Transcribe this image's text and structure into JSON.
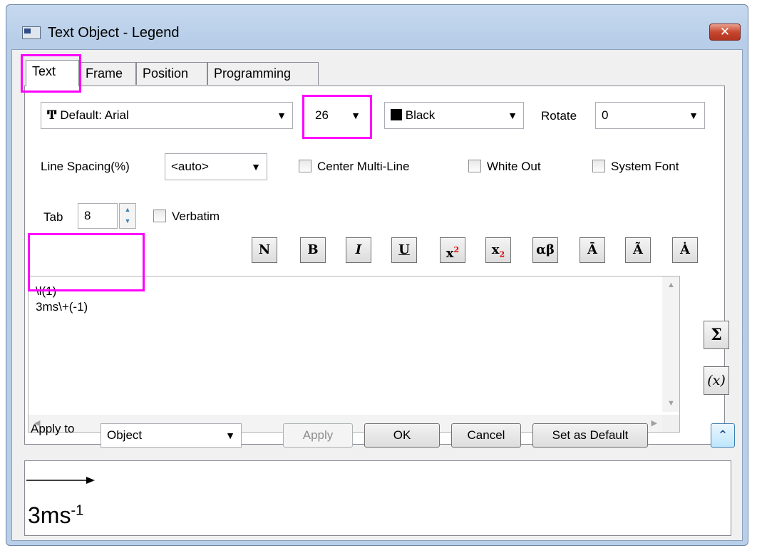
{
  "window": {
    "title": "Text Object - Legend",
    "close": "✕"
  },
  "tabs": [
    {
      "label": "Text"
    },
    {
      "label": "Frame"
    },
    {
      "label": "Position"
    },
    {
      "label": "Programming"
    }
  ],
  "font": {
    "icon": "Ͳ",
    "label": "Default: Arial"
  },
  "size": {
    "value": "26"
  },
  "color": {
    "label": "Black",
    "swatch": "#000000"
  },
  "rotate": {
    "label": "Rotate",
    "value": "0"
  },
  "line_spacing": {
    "label": "Line Spacing(%)",
    "value": "<auto>"
  },
  "checks": {
    "center": "Center Multi-Line",
    "white_out": "White Out",
    "system_font": "System Font",
    "verbatim": "Verbatim"
  },
  "tab_setting": {
    "label": "Tab",
    "value": "8"
  },
  "format_buttons": [
    {
      "name": "normal-button",
      "glyph": "N"
    },
    {
      "name": "bold-button",
      "glyph": "B"
    },
    {
      "name": "italic-button",
      "glyph": "I"
    },
    {
      "name": "underline-button",
      "glyph": "U"
    },
    {
      "name": "superscript-button",
      "glyph": "x",
      "sub": "2"
    },
    {
      "name": "subscript-button",
      "glyph": "x",
      "sub": "2"
    },
    {
      "name": "greek-button",
      "glyph": "αβ"
    },
    {
      "name": "overbar-button",
      "glyph": "Ā"
    },
    {
      "name": "tilde-button",
      "glyph": "Ã"
    },
    {
      "name": "dot-button",
      "glyph": "Ȧ"
    }
  ],
  "editor": {
    "text": "\\l(1)\n3ms\\+(-1)"
  },
  "side_buttons": {
    "sigma": "Σ",
    "function": "(x)"
  },
  "apply_to": {
    "label": "Apply to",
    "value": "Object"
  },
  "buttons": {
    "apply": "Apply",
    "ok": "OK",
    "cancel": "Cancel",
    "default": "Set as Default",
    "collapse": "⌃"
  },
  "preview": {
    "text": "3ms",
    "sup": "-1"
  }
}
